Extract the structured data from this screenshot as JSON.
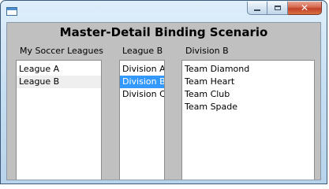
{
  "window": {
    "title": "",
    "caption_buttons": {
      "minimize_icon": "minimize-icon",
      "maximize_icon": "maximize-icon",
      "close_icon": "close-icon",
      "close_glyph": "✕"
    }
  },
  "main": {
    "title": "Master-Detail Binding Scenario",
    "leagues": {
      "label": "My Soccer Leagues",
      "items": [
        "League A",
        "League B"
      ],
      "highlighted_index": 1
    },
    "divisions": {
      "label": "League B",
      "items": [
        "Division A",
        "Division B",
        "Division C"
      ],
      "selected_index": 1
    },
    "teams": {
      "label": "Division B",
      "items": [
        "Team Diamond",
        "Team Heart",
        "Team Club",
        "Team Spade"
      ]
    }
  },
  "colors": {
    "selection": "#3399ff",
    "client_background": "#c0c0c0",
    "close_button": "#c0412a"
  }
}
